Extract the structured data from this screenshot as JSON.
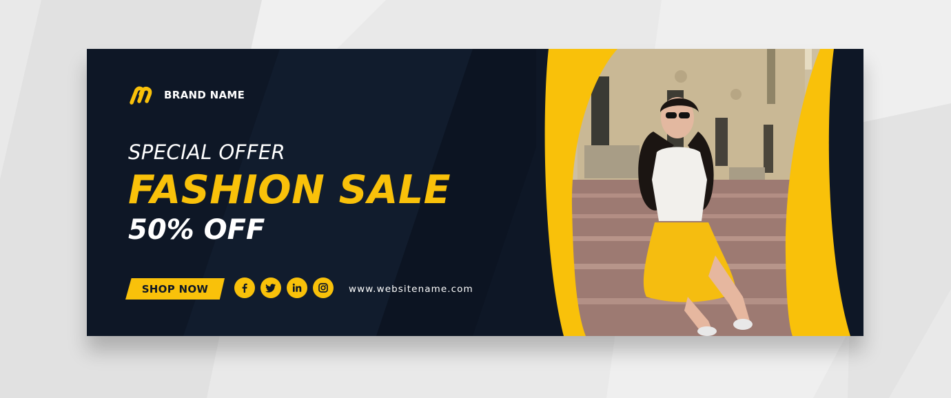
{
  "brand": {
    "name": "BRAND NAME",
    "logo_icon": "brand-logo-icon"
  },
  "headline": {
    "special_offer": "SPECIAL OFFER",
    "title": "FASHION SALE",
    "discount": "50% OFF"
  },
  "cta": {
    "shop_label": "SHOP NOW"
  },
  "socials": [
    {
      "icon": "facebook-icon"
    },
    {
      "icon": "twitter-icon"
    },
    {
      "icon": "linkedin-icon"
    },
    {
      "icon": "instagram-icon"
    }
  ],
  "website": "www.websitename.com",
  "colors": {
    "accent": "#f9c10a",
    "dark": "#0e1726",
    "text": "#ffffff",
    "background": "#e9e9e9"
  }
}
